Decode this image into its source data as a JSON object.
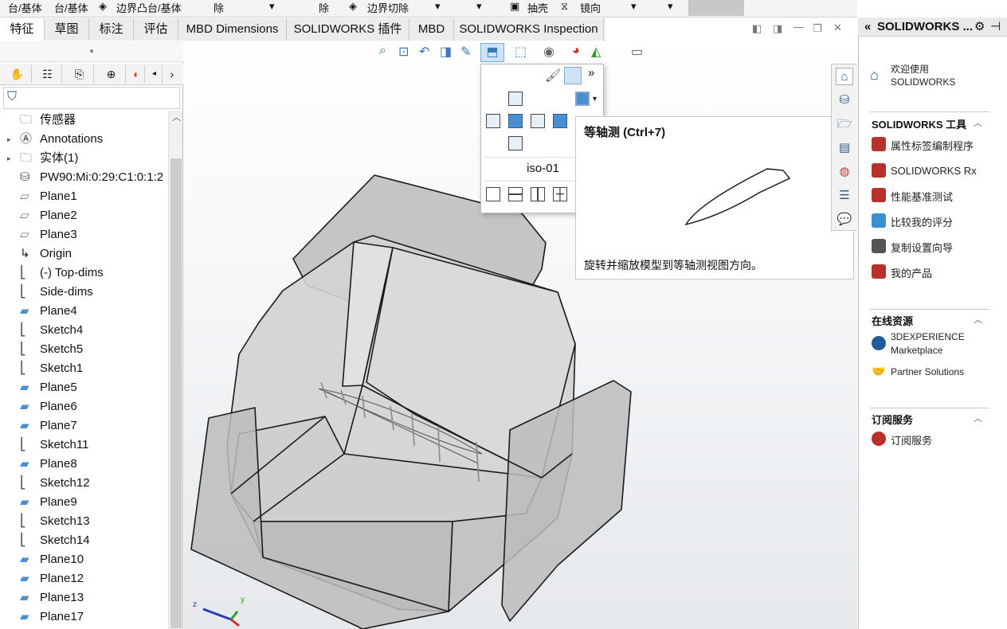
{
  "ribbon": {
    "items": [
      "台/基体",
      "台/基体",
      "边界凸台/基体",
      "除",
      "除",
      "边界切除",
      "抽壳",
      "镜向"
    ]
  },
  "command_tabs": [
    "特征",
    "草图",
    "标注",
    "评估",
    "MBD Dimensions",
    "SOLIDWORKS 插件",
    "MBD",
    "SOLIDWORKS Inspection"
  ],
  "active_tab": "特征",
  "feature_tree": {
    "items": [
      {
        "label": "传感器",
        "icon": "sensor-icon",
        "expandable": false
      },
      {
        "label": "Annotations",
        "icon": "annotations-icon",
        "expandable": true
      },
      {
        "label": "实体(1)",
        "icon": "solid-bodies-icon",
        "expandable": true
      },
      {
        "label": "PW90:Mi:0:29:C1:0:1:2",
        "icon": "material-icon",
        "expandable": false
      },
      {
        "label": "Plane1",
        "icon": "plane-icon",
        "expandable": false
      },
      {
        "label": "Plane2",
        "icon": "plane-icon",
        "expandable": false
      },
      {
        "label": "Plane3",
        "icon": "plane-icon",
        "expandable": false
      },
      {
        "label": "Origin",
        "icon": "origin-icon",
        "expandable": false
      },
      {
        "label": "(-) Top-dims",
        "icon": "sketch-icon",
        "expandable": false
      },
      {
        "label": "Side-dims",
        "icon": "sketch-icon",
        "expandable": false
      },
      {
        "label": "Plane4",
        "icon": "plane-blue-icon",
        "expandable": false
      },
      {
        "label": "Sketch4",
        "icon": "sketch-icon",
        "expandable": false
      },
      {
        "label": "Sketch5",
        "icon": "sketch-icon",
        "expandable": false
      },
      {
        "label": "Sketch1",
        "icon": "sketch-icon",
        "expandable": false
      },
      {
        "label": "Plane5",
        "icon": "plane-blue-icon",
        "expandable": false
      },
      {
        "label": "Plane6",
        "icon": "plane-blue-icon",
        "expandable": false
      },
      {
        "label": "Plane7",
        "icon": "plane-blue-icon",
        "expandable": false
      },
      {
        "label": "Sketch11",
        "icon": "sketch-icon",
        "expandable": false
      },
      {
        "label": "Plane8",
        "icon": "plane-blue-icon",
        "expandable": false
      },
      {
        "label": "Sketch12",
        "icon": "sketch-icon",
        "expandable": false
      },
      {
        "label": "Plane9",
        "icon": "plane-blue-icon",
        "expandable": false
      },
      {
        "label": "Sketch13",
        "icon": "sketch-icon",
        "expandable": false
      },
      {
        "label": "Sketch14",
        "icon": "sketch-icon",
        "expandable": false
      },
      {
        "label": "Plane10",
        "icon": "plane-blue-icon",
        "expandable": false
      },
      {
        "label": "Plane12",
        "icon": "plane-blue-icon",
        "expandable": false
      },
      {
        "label": "Plane13",
        "icon": "plane-blue-icon",
        "expandable": false
      },
      {
        "label": "Plane17",
        "icon": "plane-blue-icon",
        "expandable": false
      }
    ]
  },
  "view_flyout": {
    "named_view": "iso-01",
    "more_glyph": "»"
  },
  "tooltip": {
    "title": "等轴测   (Ctrl+7)",
    "description": "旋转并缩放模型到等轴测视图方向。"
  },
  "task_pane": {
    "title": "SOLIDWORKS ...",
    "welcome": [
      "欢迎使用",
      "SOLIDWORKS"
    ],
    "tools_header": "SOLIDWORKS 工具",
    "tools": [
      "属性标签编制程序",
      "SOLIDWORKS Rx",
      "性能基准测试",
      "比较我的评分",
      "复制设置向导",
      "我的产品"
    ],
    "online_header": "在线资源",
    "online": [
      "3DEXPERIENCE",
      "Marketplace",
      "Partner Solutions"
    ],
    "subscription_header": "订阅服务",
    "subscription": [
      "订阅服务"
    ]
  },
  "colors": {
    "accent": "#3a78b8",
    "plane_blue": "#4a8fcf",
    "model_gray": "#c9c9c9"
  }
}
